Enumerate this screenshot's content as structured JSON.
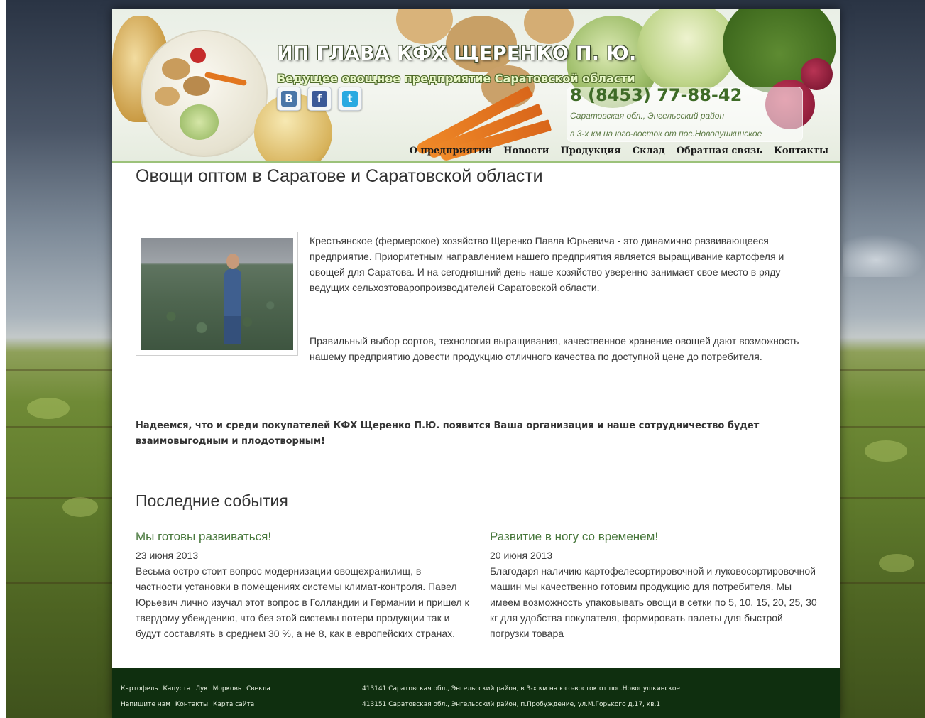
{
  "header": {
    "title": "ИП ГЛАВА КФХ ЩЕРЕНКО П. Ю.",
    "subtitle": "Ведущее овощное предприятие Саратовской области",
    "phone": "8 (8453) 77-88-42",
    "address_line1": "Саратовская обл., Энгельсский район",
    "address_line2": "в 3-х км на юго-восток от пос.Новопушкинское",
    "social": [
      {
        "label": "В",
        "icon": "vkontakte-icon",
        "color": "#4a76a8"
      },
      {
        "label": "f",
        "icon": "facebook-icon",
        "color": "#3b5998"
      },
      {
        "label": "t",
        "icon": "twitter-icon",
        "color": "#29a9e1"
      }
    ]
  },
  "nav": {
    "items": [
      "О предприятии",
      "Новости",
      "Продукция",
      "Склад",
      "Обратная связь",
      "Контакты"
    ]
  },
  "main": {
    "title": "Овощи оптом в Саратове и Саратовской области",
    "paragraph1": "Крестьянское (фермерское) хозяйство Щеренко Павла Юрьевича - это динамично развивающееся предприятие. Приоритетным направлением нашего предприятия является выращивание картофеля и овощей для Саратова. И на сегодняшний день наше хозяйство уверенно занимает свое место  в ряду ведущих сельхозтоваропроизводителей Саратовской области.",
    "paragraph2": "Правильный выбор сортов, технология выращивания, качественное хранение овощей дают возможность нашему предприятию довести продукцию отличного качества по доступной цене до потребителя.",
    "bold_paragraph": "Надеемся, что и среди покупателей КФХ Щеренко П.Ю. появится Ваша организация и наше сотрудничество будет взаимовыгодным и плодотворным!"
  },
  "events": {
    "title": "Последние события",
    "items": [
      {
        "title": "Мы готовы развиваться!",
        "date": "23 июня 2013",
        "text": "Весьма остро стоит вопрос модернизации овощехранилищ, в частности установки в помещениях системы климат-контроля. Павел Юрьевич лично изучал этот вопрос в Голландии и Германии и пришел к твердому убеждению, что без этой системы потери продукции так и будут составлять в среднем 30 %, а не 8, как в европейских странах."
      },
      {
        "title": "Развитие в ногу со временем!",
        "date": "20 июня 2013",
        "text": "Благодаря наличию картофелесортировочной и луковосортировочной машин мы качественно готовим продукцию для потребителя. Мы имеем возможность упаковывать овощи в сетки по 5, 10, 15, 20, 25, 30 кг для удобства покупателя, формировать палеты для быстрой погрузки товара"
      }
    ]
  },
  "footer": {
    "products": [
      "Картофель",
      "Капуста",
      "Лук",
      "Морковь",
      "Свекла"
    ],
    "links": [
      "Напишите нам",
      "Контакты",
      "Карта сайта"
    ],
    "address1": "413141 Саратовская обл., Энгельсский район, в 3-х км на юго-восток от пос.Новопушкинское",
    "address2": "413151 Саратовская обл., Энгельсский район, п.Пробуждение, ул.М.Горького д.17, кв.1"
  }
}
